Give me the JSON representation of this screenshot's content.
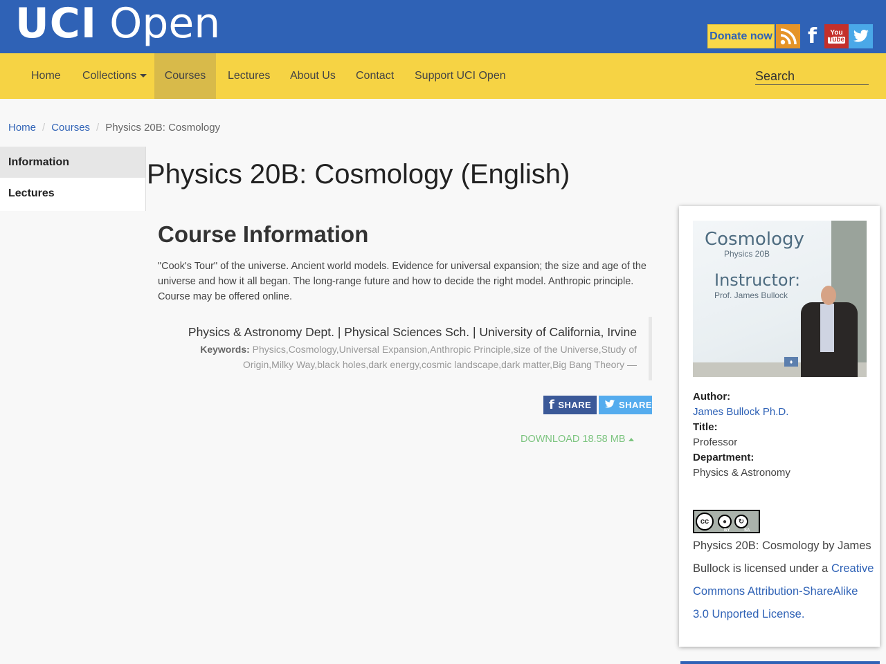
{
  "header": {
    "logo_uci": "UCI",
    "logo_open": "Open",
    "donate_label": "Donate now",
    "social": [
      "rss-icon",
      "facebook-icon",
      "youtube-icon",
      "twitter-icon"
    ],
    "youtube_top": "You",
    "youtube_bottom": "Tube"
  },
  "nav": {
    "items": [
      {
        "label": "Home"
      },
      {
        "label": "Collections"
      },
      {
        "label": "Courses"
      },
      {
        "label": "Lectures"
      },
      {
        "label": "About Us"
      },
      {
        "label": "Contact"
      },
      {
        "label": "Support UCI Open"
      }
    ],
    "search_placeholder": "Search"
  },
  "breadcrumb": {
    "items": [
      "Home",
      "Courses",
      "Physics 20B: Cosmology"
    ],
    "separator": "/"
  },
  "sidebar": {
    "items": [
      {
        "label": "Information"
      },
      {
        "label": "Lectures"
      }
    ]
  },
  "main": {
    "title": "Physics 20B: Cosmology (English)",
    "section_title": "Course Information",
    "description": "\"Cook's Tour\" of the universe. Ancient world models. Evidence for universal expansion; the size and age of the universe and how it all began. The long-range future and how to decide the right model. Anthropic principle. Course may be offered online.",
    "dept_line": "Physics & Astronomy Dept. | Physical Sciences Sch. | University of California, Irvine",
    "keywords_label": "Keywords:",
    "keywords": "Physics,Cosmology,Universal Expansion,Anthropic Principle,size of the Universe,Study of Origin,Milky Way,black holes,dark energy,cosmic landscape,dark matter,Big Bang Theory —",
    "share_fb": "SHARE",
    "share_tw": "SHARE",
    "download_label": "DOWNLOAD 18.58 MB"
  },
  "card": {
    "thumb": {
      "title": "Cosmology",
      "subtitle": "Physics 20B",
      "instructor_label": "Instructor:",
      "instructor_name": "Prof. James Bullock"
    },
    "author_label": "Author:",
    "author": "James Bullock Ph.D.",
    "title_label": "Title:",
    "title": "Professor",
    "department_label": "Department:",
    "department": "Physics & Astronomy",
    "cc_badge": "cc",
    "cc_by": "BY",
    "cc_sa": "SA",
    "license_text_1": "Physics 20B: Cosmology by James Bullock is licensed under a",
    "license_link": "Creative Commons Attribution-ShareAlike 3.0 Unported License."
  },
  "colors": {
    "brand_blue": "#2f62b6",
    "nav_yellow": "#f6d344",
    "download_green": "#7cc47f"
  }
}
